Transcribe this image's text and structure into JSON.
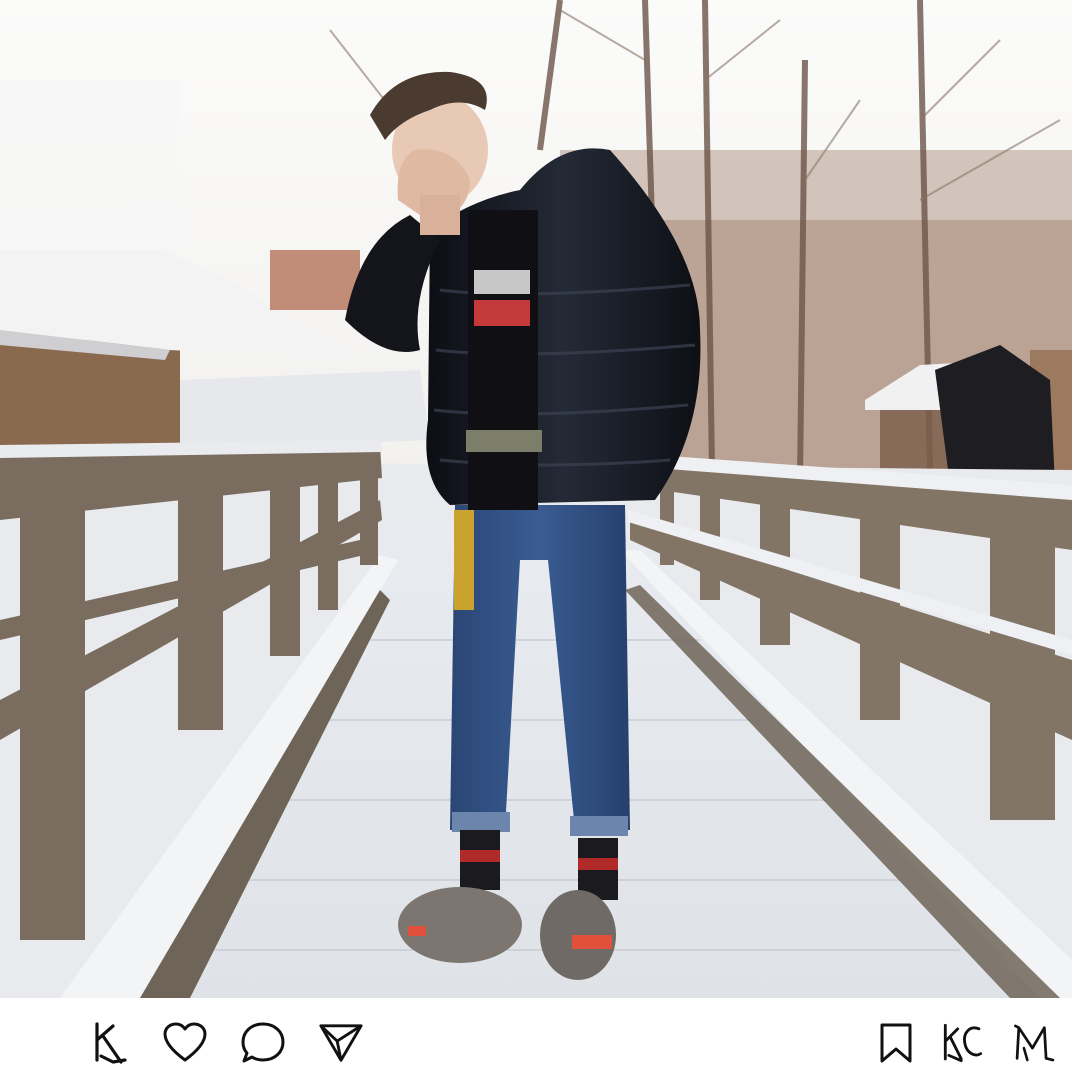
{
  "post": {
    "photo": {
      "description_icon": "photo-snowy-bridge",
      "colors": {
        "sky": "#f4f3f1",
        "snow": "#eef0f3",
        "wood": "#7a6e60",
        "jacket": "#14161c",
        "jeans": "#2f4f80"
      }
    },
    "actions": {
      "left": [
        {
          "icon": "custom-k-mark-icon"
        },
        {
          "icon": "heart-icon"
        },
        {
          "icon": "comment-bubble-icon"
        },
        {
          "icon": "send-paper-plane-icon"
        }
      ],
      "right": [
        {
          "icon": "bookmark-icon"
        },
        {
          "icon": "custom-kc-mark-icon"
        },
        {
          "icon": "custom-m-mark-icon"
        }
      ]
    }
  }
}
